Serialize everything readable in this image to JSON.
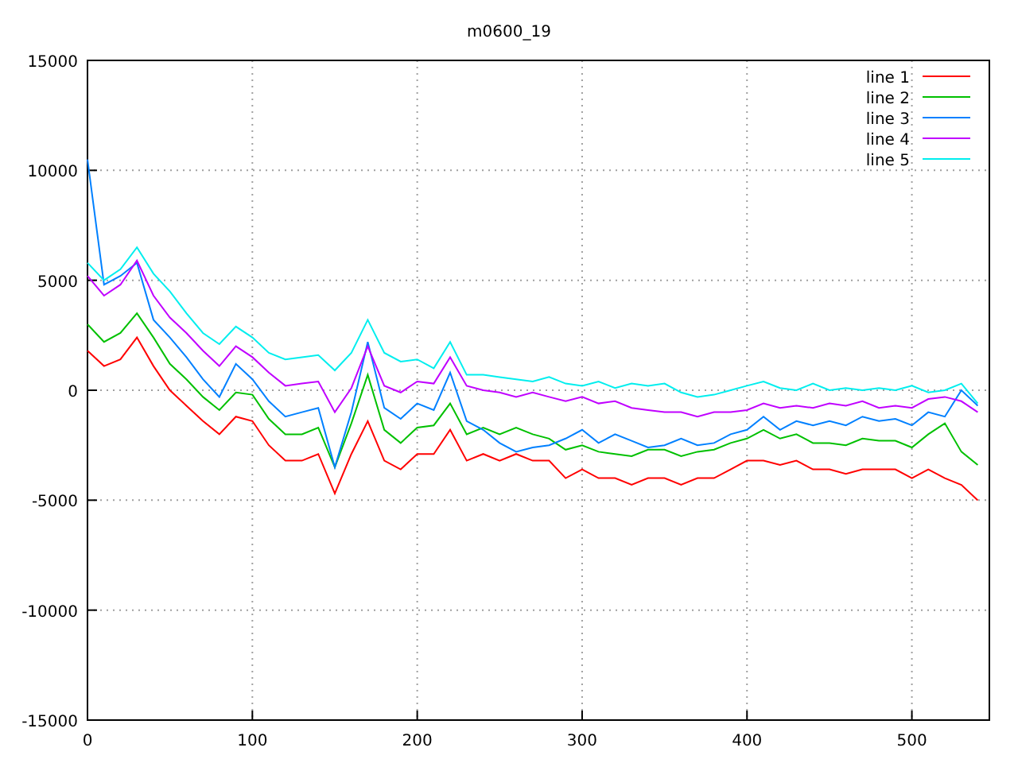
{
  "chart": {
    "chart_data": {
      "type": "line",
      "title": "m0600_19",
      "grid": true,
      "legend": true,
      "x": [
        0,
        10,
        20,
        30,
        40,
        50,
        60,
        70,
        80,
        90,
        100,
        110,
        120,
        130,
        140,
        150,
        160,
        170,
        180,
        190,
        200,
        210,
        220,
        230,
        240,
        250,
        260,
        270,
        280,
        290,
        300,
        310,
        320,
        330,
        340,
        350,
        360,
        370,
        380,
        390,
        400,
        410,
        420,
        430,
        440,
        450,
        460,
        470,
        480,
        490,
        500,
        510,
        520,
        530,
        540
      ],
      "xlim": [
        0,
        547
      ],
      "ylim": [
        -15000,
        15000
      ],
      "xticks": [
        0,
        100,
        200,
        300,
        400,
        500
      ],
      "yticks": [
        -15000,
        -10000,
        -5000,
        0,
        5000,
        10000,
        15000
      ],
      "series": [
        {
          "name": "line 1",
          "color": "#ff0000",
          "values": [
            1800,
            1100,
            1400,
            2400,
            1100,
            0,
            -700,
            -1400,
            -2000,
            -1200,
            -1400,
            -2500,
            -3200,
            -3200,
            -2900,
            -4700,
            -2900,
            -1400,
            -3200,
            -3600,
            -2900,
            -2900,
            -1800,
            -3200,
            -2900,
            -3200,
            -2900,
            -3200,
            -3200,
            -4000,
            -3600,
            -4000,
            -4000,
            -4300,
            -4000,
            -4000,
            -4300,
            -4000,
            -4000,
            -3600,
            -3200,
            -3200,
            -3400,
            -3200,
            -3600,
            -3600,
            -3800,
            -3600,
            -3600,
            -3600,
            -4000,
            -3600,
            -4000,
            -4300,
            -5000
          ]
        },
        {
          "name": "line 2",
          "color": "#00c000",
          "values": [
            3000,
            2200,
            2600,
            3500,
            2400,
            1200,
            500,
            -300,
            -900,
            -100,
            -200,
            -1300,
            -2000,
            -2000,
            -1700,
            -3500,
            -1500,
            700,
            -1800,
            -2400,
            -1700,
            -1600,
            -600,
            -2000,
            -1700,
            -2000,
            -1700,
            -2000,
            -2200,
            -2700,
            -2500,
            -2800,
            -2900,
            -3000,
            -2700,
            -2700,
            -3000,
            -2800,
            -2700,
            -2400,
            -2200,
            -1800,
            -2200,
            -2000,
            -2400,
            -2400,
            -2500,
            -2200,
            -2300,
            -2300,
            -2600,
            -2000,
            -1500,
            -2800,
            -3400
          ]
        },
        {
          "name": "line 3",
          "color": "#0080ff",
          "values": [
            10500,
            4800,
            5200,
            5800,
            3200,
            2400,
            1500,
            500,
            -300,
            1200,
            500,
            -500,
            -1200,
            -1000,
            -800,
            -3500,
            -1000,
            2200,
            -800,
            -1300,
            -600,
            -900,
            800,
            -1400,
            -1800,
            -2400,
            -2800,
            -2600,
            -2500,
            -2200,
            -1800,
            -2400,
            -2000,
            -2300,
            -2600,
            -2500,
            -2200,
            -2500,
            -2400,
            -2000,
            -1800,
            -1200,
            -1800,
            -1400,
            -1600,
            -1400,
            -1600,
            -1200,
            -1400,
            -1300,
            -1600,
            -1000,
            -1200,
            0,
            -700
          ]
        },
        {
          "name": "line 4",
          "color": "#c000ff",
          "values": [
            5200,
            4300,
            4800,
            5900,
            4300,
            3300,
            2600,
            1800,
            1100,
            2000,
            1500,
            800,
            200,
            300,
            400,
            -1000,
            100,
            2000,
            200,
            -100,
            400,
            300,
            1500,
            200,
            0,
            -100,
            -300,
            -100,
            -300,
            -500,
            -300,
            -600,
            -500,
            -800,
            -900,
            -1000,
            -1000,
            -1200,
            -1000,
            -1000,
            -900,
            -600,
            -800,
            -700,
            -800,
            -600,
            -700,
            -500,
            -800,
            -700,
            -800,
            -400,
            -300,
            -500,
            -1000
          ]
        },
        {
          "name": "line 5",
          "color": "#00eeee",
          "values": [
            5800,
            5000,
            5500,
            6500,
            5300,
            4500,
            3500,
            2600,
            2100,
            2900,
            2400,
            1700,
            1400,
            1500,
            1600,
            900,
            1700,
            3200,
            1700,
            1300,
            1400,
            1000,
            2200,
            700,
            700,
            600,
            500,
            400,
            600,
            300,
            200,
            400,
            100,
            300,
            200,
            300,
            -100,
            -300,
            -200,
            0,
            200,
            400,
            100,
            0,
            300,
            0,
            100,
            0,
            100,
            0,
            200,
            -100,
            0,
            300,
            -600
          ]
        }
      ]
    }
  }
}
